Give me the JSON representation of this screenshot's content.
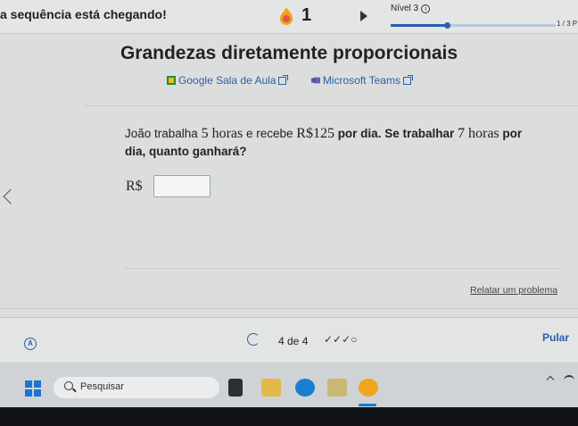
{
  "header": {
    "streak_message": "a sequência está chegando!",
    "streak_count": "1",
    "level_label": "Nível 3",
    "level_info_symbol": "i",
    "level_progress": 0.34,
    "page_count": "1 / 3 P"
  },
  "main": {
    "title": "Grandezas diretamente proporcionais",
    "links": {
      "google_classroom": "Google Sala de Aula",
      "microsoft_teams": "Microsoft Teams"
    },
    "question": {
      "part1": "João trabalha ",
      "hours1": "5 horas",
      "part2": " e recebe ",
      "amount": "R$125",
      "part3": " por dia. Se trabalhar ",
      "hours2": "7 horas",
      "part4": " por",
      "line2": "dia, quanto ganhará?"
    },
    "answer_prefix": "R$",
    "answer_value": "",
    "report_link": "Relatar um problema"
  },
  "footer": {
    "help_symbol": "A",
    "progress": "4 de 4",
    "checks": "✓✓✓○",
    "skip_label": "Pular"
  },
  "taskbar": {
    "search_placeholder": "Pesquisar"
  },
  "colors": {
    "accent": "#2a5db0",
    "link": "#2b5fa8",
    "background": "#dcdedd",
    "taskbar": "#cfd3d6"
  }
}
